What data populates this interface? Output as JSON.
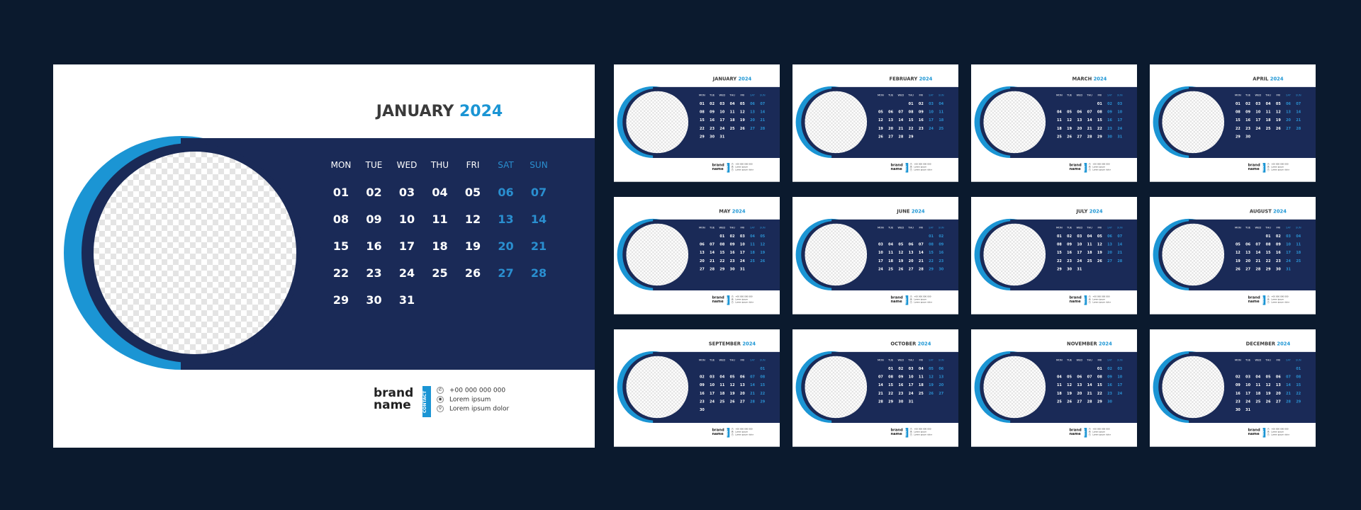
{
  "colors": {
    "background": "#0b1a2e",
    "band": "#1a2a57",
    "accent": "#1b95d4",
    "weekend": "#2a8fd0"
  },
  "weekdays": [
    "MON",
    "TUE",
    "WED",
    "THU",
    "FRI",
    "SAT",
    "SUN"
  ],
  "year": "2024",
  "brand": {
    "line1": "brand",
    "line2": "name"
  },
  "contact": {
    "label": "CONTACT",
    "phone": "+00 000 000 000",
    "line2": "Lorem ipsum",
    "line3": "Lorem ipsum dolor",
    "icons": [
      "phone-icon",
      "globe-icon",
      "location-icon"
    ]
  },
  "months": [
    {
      "name": "JANUARY",
      "weeks": [
        [
          "01",
          "02",
          "03",
          "04",
          "05",
          "06",
          "07"
        ],
        [
          "08",
          "09",
          "10",
          "11",
          "12",
          "13",
          "14"
        ],
        [
          "15",
          "16",
          "17",
          "18",
          "19",
          "20",
          "21"
        ],
        [
          "22",
          "23",
          "24",
          "25",
          "26",
          "27",
          "28"
        ],
        [
          "29",
          "30",
          "31",
          "",
          "",
          "",
          ""
        ]
      ]
    },
    {
      "name": "FEBRUARY",
      "weeks": [
        [
          "",
          "",
          "",
          "01",
          "02",
          "03",
          "04"
        ],
        [
          "05",
          "06",
          "07",
          "08",
          "09",
          "10",
          "11"
        ],
        [
          "12",
          "13",
          "14",
          "15",
          "16",
          "17",
          "18"
        ],
        [
          "19",
          "20",
          "21",
          "22",
          "23",
          "24",
          "25"
        ],
        [
          "26",
          "27",
          "28",
          "29",
          "",
          "",
          ""
        ]
      ]
    },
    {
      "name": "MARCH",
      "weeks": [
        [
          "",
          "",
          "",
          "",
          "01",
          "02",
          "03"
        ],
        [
          "04",
          "05",
          "06",
          "07",
          "08",
          "09",
          "10"
        ],
        [
          "11",
          "12",
          "13",
          "14",
          "15",
          "16",
          "17"
        ],
        [
          "18",
          "19",
          "20",
          "21",
          "22",
          "23",
          "24"
        ],
        [
          "25",
          "26",
          "27",
          "28",
          "29",
          "30",
          "31"
        ]
      ]
    },
    {
      "name": "APRIL",
      "weeks": [
        [
          "01",
          "02",
          "03",
          "04",
          "05",
          "06",
          "07"
        ],
        [
          "08",
          "09",
          "10",
          "11",
          "12",
          "13",
          "14"
        ],
        [
          "15",
          "16",
          "17",
          "18",
          "19",
          "20",
          "21"
        ],
        [
          "22",
          "23",
          "24",
          "25",
          "26",
          "27",
          "28"
        ],
        [
          "29",
          "30",
          "",
          "",
          "",
          "",
          ""
        ]
      ]
    },
    {
      "name": "MAY",
      "weeks": [
        [
          "",
          "",
          "01",
          "02",
          "03",
          "04",
          "05"
        ],
        [
          "06",
          "07",
          "08",
          "09",
          "10",
          "11",
          "12"
        ],
        [
          "13",
          "14",
          "15",
          "16",
          "17",
          "18",
          "19"
        ],
        [
          "20",
          "21",
          "22",
          "23",
          "24",
          "25",
          "26"
        ],
        [
          "27",
          "28",
          "29",
          "30",
          "31",
          "",
          ""
        ]
      ]
    },
    {
      "name": "JUNE",
      "weeks": [
        [
          "",
          "",
          "",
          "",
          "",
          "01",
          "02"
        ],
        [
          "03",
          "04",
          "05",
          "06",
          "07",
          "08",
          "09"
        ],
        [
          "10",
          "11",
          "12",
          "13",
          "14",
          "15",
          "16"
        ],
        [
          "17",
          "18",
          "19",
          "20",
          "21",
          "22",
          "23"
        ],
        [
          "24",
          "25",
          "26",
          "27",
          "28",
          "29",
          "30"
        ]
      ]
    },
    {
      "name": "JULY",
      "weeks": [
        [
          "01",
          "02",
          "03",
          "04",
          "05",
          "06",
          "07"
        ],
        [
          "08",
          "09",
          "10",
          "11",
          "12",
          "13",
          "14"
        ],
        [
          "15",
          "16",
          "17",
          "18",
          "19",
          "20",
          "21"
        ],
        [
          "22",
          "23",
          "24",
          "25",
          "26",
          "27",
          "28"
        ],
        [
          "29",
          "30",
          "31",
          "",
          "",
          "",
          ""
        ]
      ]
    },
    {
      "name": "AUGUST",
      "weeks": [
        [
          "",
          "",
          "",
          "01",
          "02",
          "03",
          "04"
        ],
        [
          "05",
          "06",
          "07",
          "08",
          "09",
          "10",
          "11"
        ],
        [
          "12",
          "13",
          "14",
          "15",
          "16",
          "17",
          "18"
        ],
        [
          "19",
          "20",
          "21",
          "22",
          "23",
          "24",
          "25"
        ],
        [
          "26",
          "27",
          "28",
          "29",
          "30",
          "31",
          ""
        ]
      ]
    },
    {
      "name": "SEPTEMBER",
      "weeks": [
        [
          "",
          "",
          "",
          "",
          "",
          "",
          "01"
        ],
        [
          "02",
          "03",
          "04",
          "05",
          "06",
          "07",
          "08"
        ],
        [
          "09",
          "10",
          "11",
          "12",
          "13",
          "14",
          "15"
        ],
        [
          "16",
          "17",
          "18",
          "19",
          "20",
          "21",
          "22"
        ],
        [
          "23",
          "24",
          "25",
          "26",
          "27",
          "28",
          "29"
        ],
        [
          "30",
          "",
          "",
          "",
          "",
          "",
          ""
        ]
      ]
    },
    {
      "name": "OCTOBER",
      "weeks": [
        [
          "",
          "01",
          "02",
          "03",
          "04",
          "05",
          "06"
        ],
        [
          "07",
          "08",
          "09",
          "10",
          "11",
          "12",
          "13"
        ],
        [
          "14",
          "15",
          "16",
          "17",
          "18",
          "19",
          "20"
        ],
        [
          "21",
          "22",
          "23",
          "24",
          "25",
          "26",
          "27"
        ],
        [
          "28",
          "29",
          "30",
          "31",
          "",
          "",
          ""
        ]
      ]
    },
    {
      "name": "NOVEMBER",
      "weeks": [
        [
          "",
          "",
          "",
          "",
          "01",
          "02",
          "03"
        ],
        [
          "04",
          "05",
          "06",
          "07",
          "08",
          "09",
          "10"
        ],
        [
          "11",
          "12",
          "13",
          "14",
          "15",
          "16",
          "17"
        ],
        [
          "18",
          "19",
          "20",
          "21",
          "22",
          "23",
          "24"
        ],
        [
          "25",
          "26",
          "27",
          "28",
          "29",
          "30",
          ""
        ]
      ]
    },
    {
      "name": "DECEMBER",
      "weeks": [
        [
          "",
          "",
          "",
          "",
          "",
          "",
          "01"
        ],
        [
          "02",
          "03",
          "04",
          "05",
          "06",
          "07",
          "08"
        ],
        [
          "09",
          "10",
          "11",
          "12",
          "13",
          "14",
          "15"
        ],
        [
          "16",
          "17",
          "18",
          "19",
          "20",
          "21",
          "22"
        ],
        [
          "23",
          "24",
          "25",
          "26",
          "27",
          "28",
          "29"
        ],
        [
          "30",
          "31",
          "",
          "",
          "",
          "",
          ""
        ]
      ]
    }
  ]
}
